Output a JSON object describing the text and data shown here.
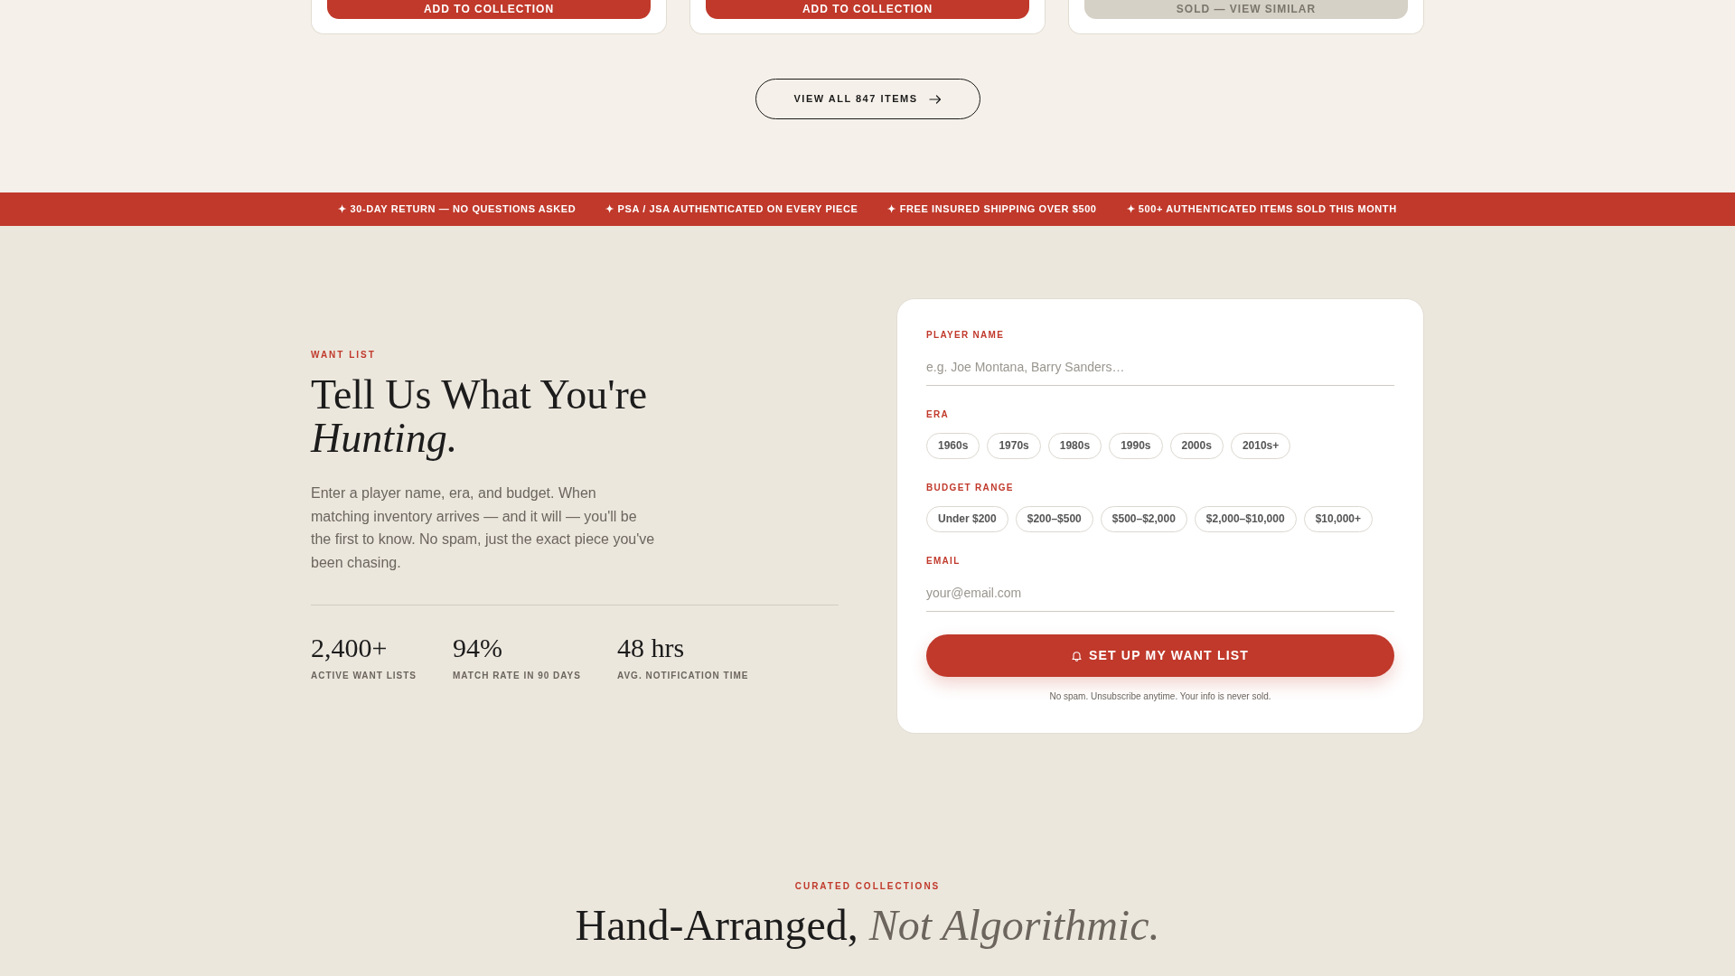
{
  "product_cards": [
    {
      "button": {
        "label": "ADD TO COLLECTION",
        "disabled": false
      }
    },
    {
      "button": {
        "label": "ADD TO COLLECTION",
        "disabled": false
      }
    },
    {
      "button": {
        "label": "SOLD — VIEW SIMILAR",
        "disabled": true
      }
    }
  ],
  "view_all_button": {
    "label": "VIEW ALL 847 ITEMS"
  },
  "trust_banner": {
    "items": [
      "✦ 30-DAY RETURN — NO QUESTIONS ASKED",
      "✦ PSA / JSA AUTHENTICATED ON EVERY PIECE",
      "✦ FREE INSURED SHIPPING OVER $500",
      "✦ 500+ AUTHENTICATED ITEMS SOLD THIS MONTH"
    ]
  },
  "want_list": {
    "eyebrow": "WANT LIST",
    "title": "Tell Us What You're *Hunting.*",
    "description": "Enter a player name, era, and budget. When matching inventory arrives — and it will — you'll be the first to know. No spam, just the exact piece you've been chasing.",
    "stats": [
      {
        "value": "2,400+",
        "label": "ACTIVE WANT LISTS"
      },
      {
        "value": "94%",
        "label": "MATCH RATE IN 90 DAYS"
      },
      {
        "value": "48 hrs",
        "label": "AVG. NOTIFICATION TIME"
      }
    ]
  },
  "form": {
    "fields": [
      {
        "kind": "text",
        "label": "PLAYER NAME",
        "placeholder": "e.g. Joe Montana, Barry Sanders…"
      },
      {
        "kind": "chips",
        "label": "ERA",
        "options": [
          {
            "label": "1960s",
            "selected": false
          },
          {
            "label": "1970s",
            "selected": false
          },
          {
            "label": "1980s",
            "selected": false
          },
          {
            "label": "1990s",
            "selected": false
          },
          {
            "label": "2000s",
            "selected": false
          },
          {
            "label": "2010s+",
            "selected": false
          }
        ]
      },
      {
        "kind": "chips",
        "label": "BUDGET RANGE",
        "options": [
          {
            "label": "Under $200",
            "selected": false
          },
          {
            "label": "$200–$500",
            "selected": false
          },
          {
            "label": "$500–$2,000",
            "selected": false
          },
          {
            "label": "$2,000–$10,000",
            "selected": false
          },
          {
            "label": "$10,000+",
            "selected": false
          }
        ]
      },
      {
        "kind": "email",
        "label": "EMAIL",
        "placeholder": "your@email.com"
      }
    ],
    "submit_button": {
      "label": "SET UP MY WANT LIST"
    },
    "note": "No spam. Unsubscribe anytime. Your info is never sold."
  },
  "collections": {
    "eyebrow": "CURATED COLLECTIONS",
    "title": "Hand-Arranged, *Not Algorithmic.*"
  }
}
